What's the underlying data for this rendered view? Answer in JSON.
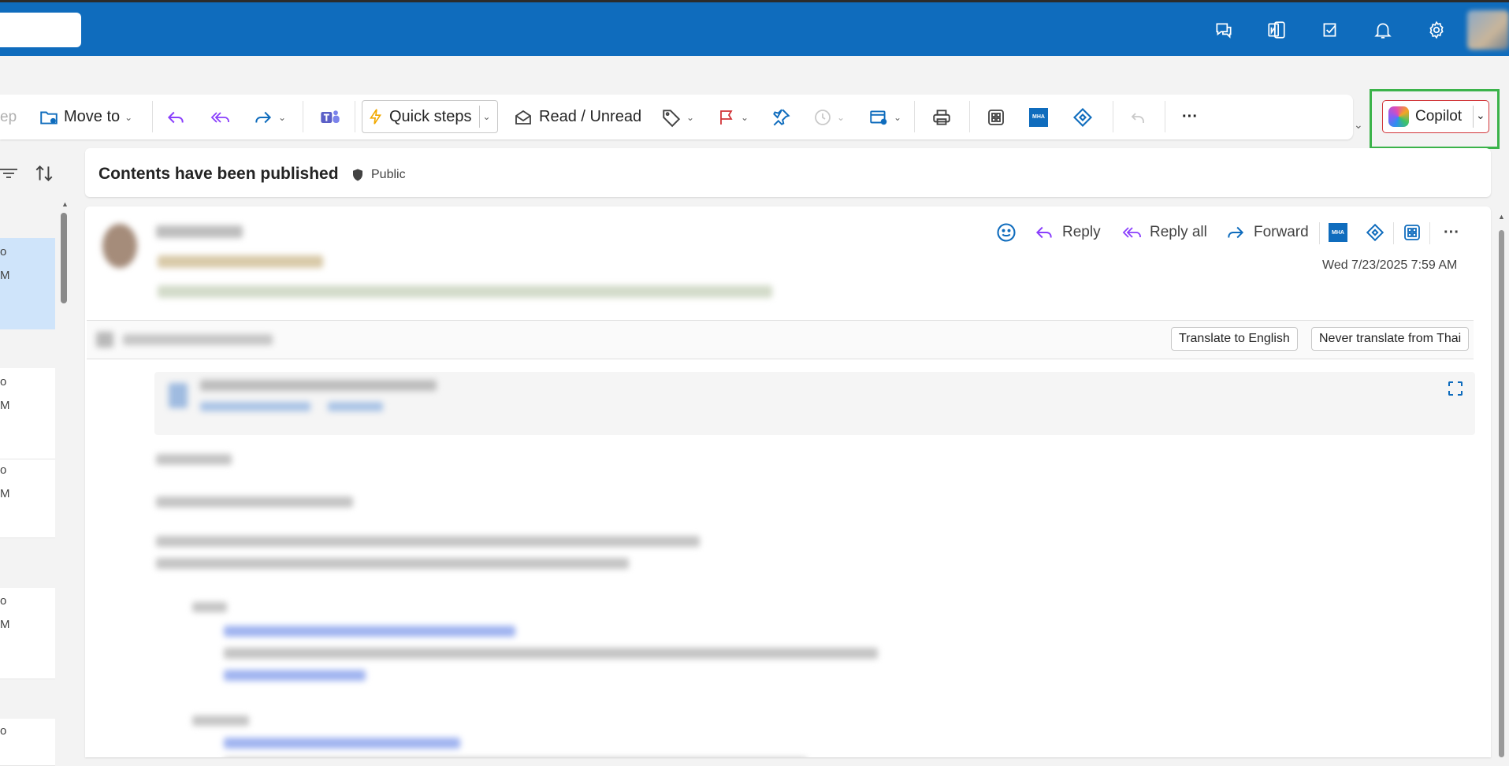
{
  "topbar": {
    "icons": [
      "chat-icon",
      "onenote-icon",
      "todo-icon",
      "bell-icon",
      "gear-icon"
    ]
  },
  "ribbon": {
    "sweep_partial": "ep",
    "move_to": "Move to",
    "quick_steps": "Quick steps",
    "read_unread": "Read / Unread",
    "mha_badge": "MHA",
    "more": "···"
  },
  "copilot": {
    "label": "Copilot",
    "highlight_color": "#3bb34a"
  },
  "list": {
    "items": [
      {
        "line1": "o",
        "line2": "M"
      },
      {
        "line1": "o",
        "line2": "M"
      },
      {
        "line1": "o",
        "line2": "M"
      },
      {
        "line1": "o",
        "line2": "M"
      },
      {
        "line1": "o",
        "line2": ""
      }
    ]
  },
  "message": {
    "subject": "Contents have been published",
    "sensitivity": "Public",
    "actions": {
      "reply": "Reply",
      "reply_all": "Reply all",
      "forward": "Forward",
      "mha_badge": "MHA",
      "more": "···"
    },
    "date": "Wed 7/23/2025 7:59 AM",
    "translate": {
      "translate_btn": "Translate to English",
      "never_btn": "Never translate from Thai"
    }
  },
  "colors": {
    "brand": "#0f6cbd",
    "accent_red": "#d13438",
    "page_bg": "#f3f3f3"
  }
}
